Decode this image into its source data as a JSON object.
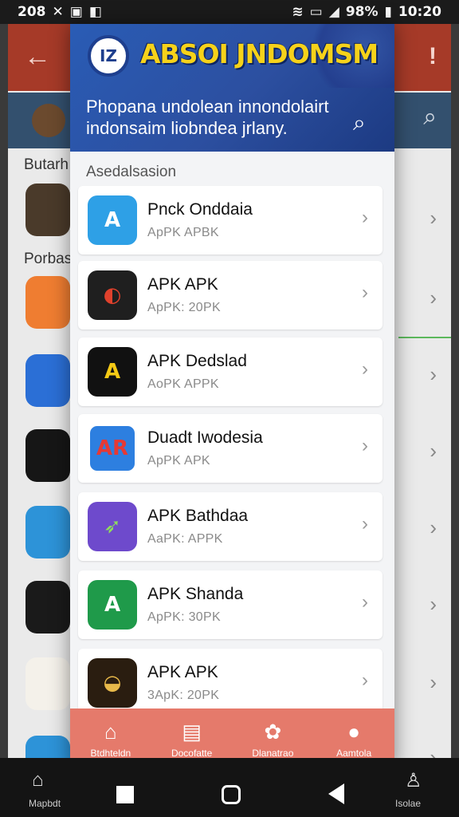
{
  "status_bar": {
    "left_text": "208",
    "battery": "98%",
    "time": "10:20"
  },
  "background_app": {
    "label_1": "Butarh",
    "label_2": "Porbast",
    "nav_left_label": "Mapbdt",
    "nav_right_label": "Isolae"
  },
  "modal": {
    "brand_title": "ABSOI JNDOMSM",
    "logo_text": "IZ",
    "hero_text": "Phopana undolean innondolairt indonsaim liobndea jrlany.",
    "section_title": "Asedalsasion",
    "apps": [
      {
        "name": "Pnck Onddaia",
        "sub": "ApPK APBK",
        "icon": "A",
        "color": "#2ea0e6",
        "icon_name": "a-logo-blue-icon"
      },
      {
        "name": "APK APK",
        "sub": "ApPK: 20PK",
        "icon": "◐",
        "color": "#1f1f1f",
        "icon_name": "target-logo-icon"
      },
      {
        "name": "APK Dedslad",
        "sub": "AoPK APPK",
        "icon": "A",
        "color": "#111111",
        "icon_name": "a-logo-yellow-icon"
      },
      {
        "name": "Duadt Iwodesia",
        "sub": "ApPK APK",
        "icon": "AR",
        "color": "#2d7fe0",
        "icon_name": "ar-logo-icon"
      },
      {
        "name": "APK Bathdaa",
        "sub": "AaPK: APPK",
        "icon": "➶",
        "color": "#6e4acc",
        "icon_name": "arrow-logo-icon"
      },
      {
        "name": "APK Shanda",
        "sub": "ApPK: 30PK",
        "icon": "A",
        "color": "#1f9a4a",
        "icon_name": "green-a-logo-icon"
      },
      {
        "name": "APK APK",
        "sub": "3ApK: 20PK",
        "icon": "◒",
        "color": "#2a1d10",
        "icon_name": "bowl-logo-icon"
      }
    ],
    "tabs": [
      {
        "label": "Btdhteldn",
        "icon": "⌂",
        "icon_name": "home-icon"
      },
      {
        "label": "Docofatte",
        "icon": "▤",
        "icon_name": "documents-icon"
      },
      {
        "label": "Dlanatrao",
        "icon": "✿",
        "icon_name": "flower-icon"
      },
      {
        "label": "Aamtola",
        "icon": "●",
        "icon_name": "account-icon"
      }
    ]
  }
}
